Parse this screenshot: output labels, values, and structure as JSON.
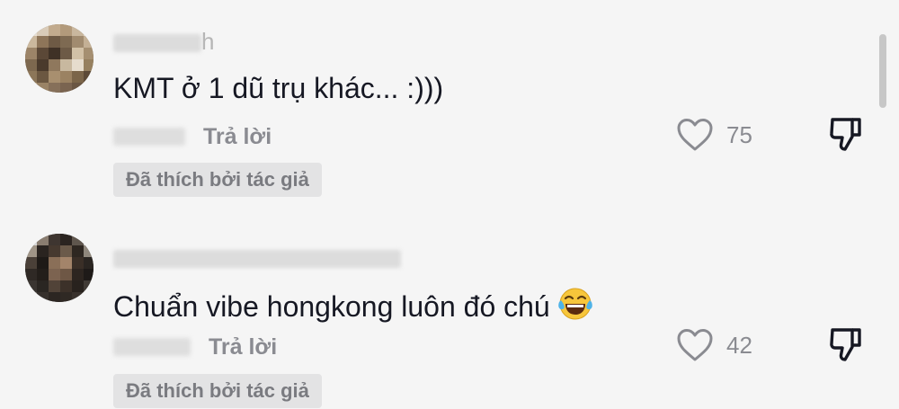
{
  "comments": [
    {
      "username_visible_tail": "h",
      "text": "KMT ở 1 dũ trụ khác... :)))",
      "reply_label": "Trả lời",
      "like_count": "75",
      "liked_badge": "Đã thích bởi tác giả"
    },
    {
      "text": "Chuẩn vibe hongkong luôn đó chú",
      "emoji": "😂",
      "reply_label": "Trả lời",
      "like_count": "42",
      "liked_badge": "Đã thích bởi tác giả"
    }
  ],
  "colors": {
    "background": "#f5f5f5",
    "text_primary": "#161823",
    "text_secondary": "#8a8b91",
    "badge_bg": "#e3e3e4"
  },
  "icons": [
    "heart-outline-icon",
    "thumbs-down-icon",
    "laughing-tears-emoji"
  ]
}
